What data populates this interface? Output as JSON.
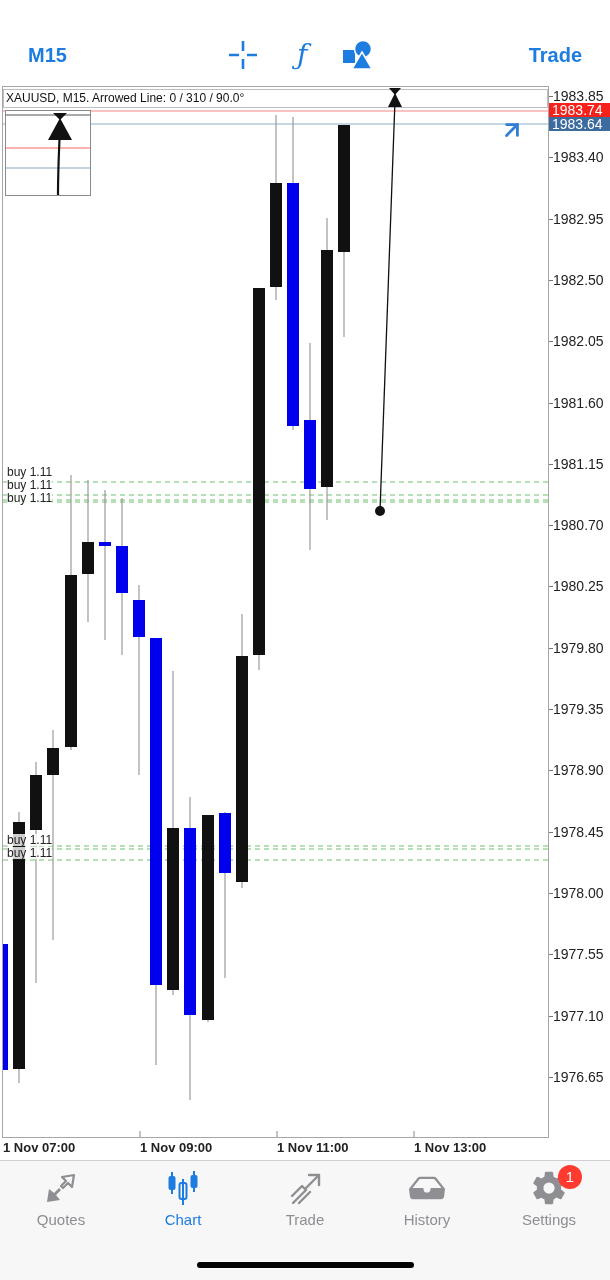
{
  "toolbar": {
    "timeframe": "M15",
    "indicators": "ƒ",
    "trade": "Trade"
  },
  "chart": {
    "info": "XAUUSD, M15. Arrowed Line: 0 / 310 / 90.0°",
    "price_axis": [
      "1983.85",
      "1983.40",
      "1982.95",
      "1982.50",
      "1982.05",
      "1981.60",
      "1981.15",
      "1980.70",
      "1980.25",
      "1979.80",
      "1979.35",
      "1978.90",
      "1978.45",
      "1978.00",
      "1977.55",
      "1977.10",
      "1976.65"
    ],
    "price_tags": [
      {
        "label": "1983.74",
        "color": "#f5221b"
      },
      {
        "label": "1983.64",
        "color": "#3c6b9e"
      }
    ],
    "orders": [
      "buy 1.11",
      "buy 1.11",
      "buy 1.11",
      "buy 1.11",
      "buy 1.11"
    ],
    "time_axis": [
      "1 Nov 07:00",
      "1 Nov 09:00",
      "1 Nov 11:00",
      "1 Nov 13:00"
    ]
  },
  "tabs": [
    {
      "label": "Quotes",
      "selected": false
    },
    {
      "label": "Chart",
      "selected": true
    },
    {
      "label": "Trade",
      "selected": false
    },
    {
      "label": "History",
      "selected": false
    },
    {
      "label": "Settings",
      "selected": false,
      "badge": "1"
    }
  ]
}
